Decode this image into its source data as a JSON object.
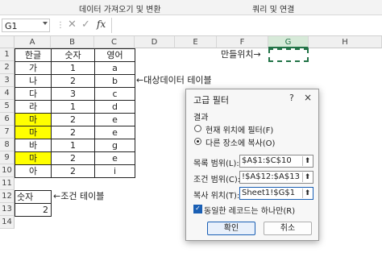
{
  "ribbon": {
    "group1": "데이터 가져오기 및 변환",
    "group2": "쿼리 및 연결"
  },
  "formula_bar": {
    "name_box": "G1",
    "cancel_icon": "close-icon",
    "enter_icon": "check-icon",
    "fx_label": "fx",
    "value": ""
  },
  "sheet": {
    "columns": [
      "A",
      "B",
      "C",
      "D",
      "E",
      "F",
      "G",
      "H"
    ],
    "selected_column": "G",
    "rows": [
      "1",
      "2",
      "3",
      "4",
      "5",
      "6",
      "7",
      "8",
      "9",
      "10",
      "11",
      "12",
      "13",
      "14"
    ],
    "table": {
      "headers": [
        "한글",
        "숫자",
        "영어"
      ],
      "rows": [
        {
          "a": "가",
          "b": "1",
          "c": "a",
          "highlight": false
        },
        {
          "a": "나",
          "b": "2",
          "c": "b",
          "highlight": false
        },
        {
          "a": "다",
          "b": "3",
          "c": "c",
          "highlight": false
        },
        {
          "a": "라",
          "b": "1",
          "c": "d",
          "highlight": false
        },
        {
          "a": "마",
          "b": "2",
          "c": "e",
          "highlight": true
        },
        {
          "a": "마",
          "b": "2",
          "c": "e",
          "highlight": true
        },
        {
          "a": "바",
          "b": "1",
          "c": "g",
          "highlight": false
        },
        {
          "a": "마",
          "b": "2",
          "c": "e",
          "highlight": true
        },
        {
          "a": "아",
          "b": "2",
          "c": "i",
          "highlight": false
        }
      ],
      "highlight_color": "#ffff00"
    },
    "criteria": {
      "header": "숫자",
      "value": "2"
    },
    "note_target_table": "←대상데이터 테이블",
    "note_criteria_table": "←조건 테이블",
    "note_output": "만들위치→"
  },
  "dialog": {
    "title": "고급 필터",
    "help": "?",
    "close": "×",
    "section": "결과",
    "radio1": "현재 위치에 필터(F)",
    "radio2": "다른 장소에 복사(O)",
    "list_range_label": "목록 범위(L):",
    "list_range_value": "$A$1:$C$10",
    "criteria_range_label": "조건 범위(C):",
    "criteria_range_value": "!$A$12:$A$13",
    "copy_to_label": "복사 위치(T):",
    "copy_to_value": "Sheet1!$G$1",
    "unique_label": "동일한 레코드는 하나만(R)",
    "ok": "확인",
    "cancel": "취소",
    "accent": "#1a5fb4"
  }
}
